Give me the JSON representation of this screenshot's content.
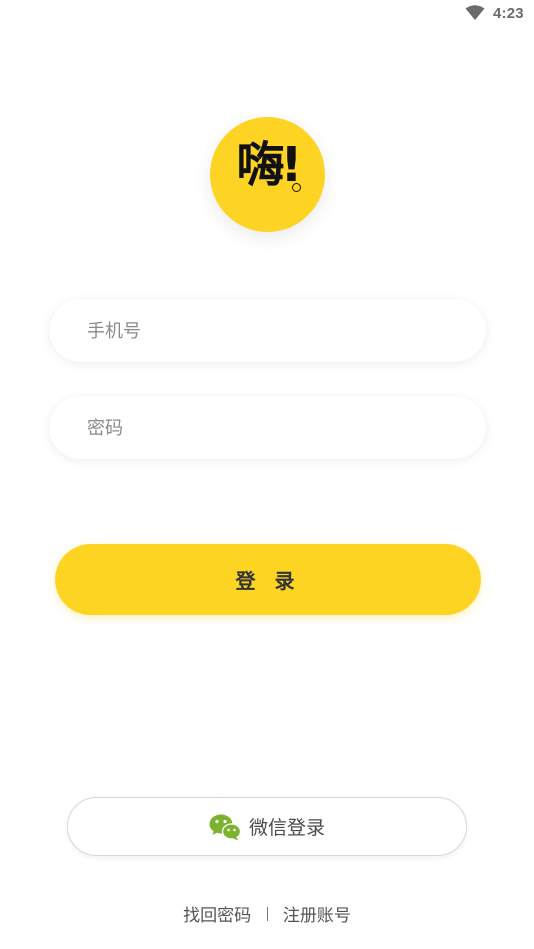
{
  "status_bar": {
    "time": "4:23",
    "wifi_icon": "wifi-icon"
  },
  "logo": {
    "text": "嗨!",
    "icon": "logo-badge",
    "background_color": "#fdd424"
  },
  "form": {
    "phone_placeholder": "手机号",
    "phone_value": "",
    "password_placeholder": "密码",
    "password_value": "",
    "login_label": "登 录",
    "login_color": "#fdd422"
  },
  "wechat": {
    "icon": "wechat-icon",
    "label": "微信登录",
    "icon_color": "#7bb32e"
  },
  "footer": {
    "recover_label": "找回密码",
    "register_label": "注册账号"
  }
}
